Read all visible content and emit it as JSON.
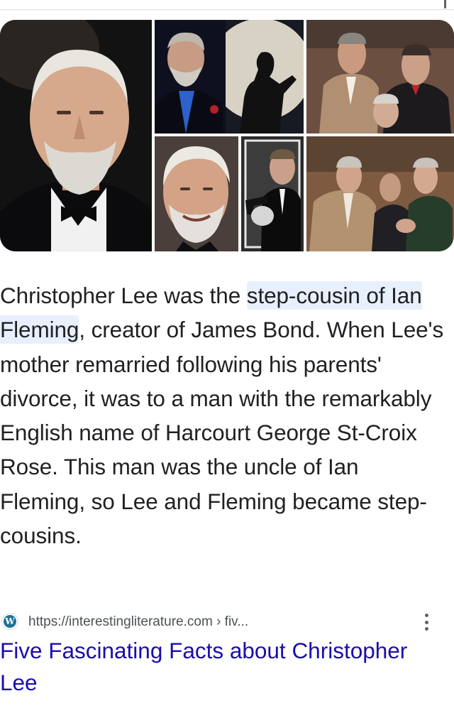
{
  "snippet": {
    "text_before": "Christopher Lee was the ",
    "highlight": "step-cousin of Ian Fleming",
    "text_after": ", creator of James Bond. When Lee's mother remarried following his parents' divorce, it was to a man with the remarkably English name of Harcourt George St-Croix Rose. This man was the uncle of Ian Fleming, so Lee and Fleming became step-cousins."
  },
  "source": {
    "favicon": "W",
    "favicon_icon": "wordpress-icon",
    "url": "https://interestingliterature.com › fiv...",
    "menu_icon": "more-vert-icon"
  },
  "result": {
    "title": "Five Fascinating Facts about Christopher Lee"
  },
  "colors": {
    "link": "#1a0dab",
    "highlight": "#e8f0fe",
    "text": "#202124",
    "url": "#4d5156"
  }
}
